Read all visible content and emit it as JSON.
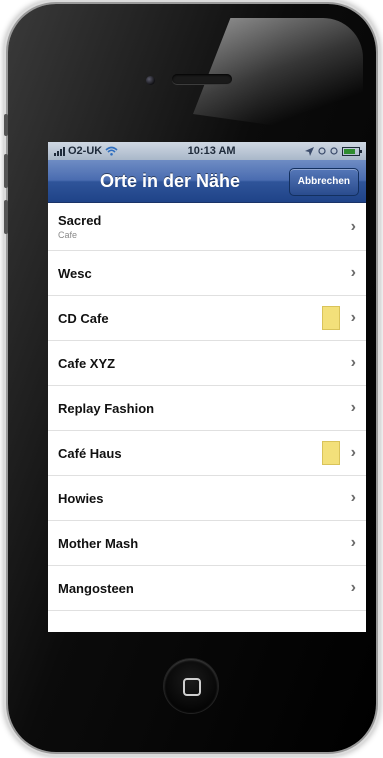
{
  "status": {
    "carrier": "O2-UK",
    "time": "10:13 AM"
  },
  "nav": {
    "title": "Orte in der Nähe",
    "cancel_label": "Abbrechen"
  },
  "places": [
    {
      "name": "Sacred",
      "category": "Cafe"
    },
    {
      "name": "Wesc"
    },
    {
      "name": "CD Cafe"
    },
    {
      "name": "Cafe XYZ"
    },
    {
      "name": "Replay Fashion"
    },
    {
      "name": "Café Haus"
    },
    {
      "name": "Howies"
    },
    {
      "name": "Mother Mash"
    },
    {
      "name": "Mangosteen"
    }
  ],
  "icons": {
    "wifi": "wifi-icon",
    "location": "location-arrow-icon",
    "battery": "battery-icon",
    "disclosure": "chevron-right-icon",
    "note": "note-icon"
  },
  "colors": {
    "navbar": "#2f5499",
    "badge": "#f3e07a"
  }
}
